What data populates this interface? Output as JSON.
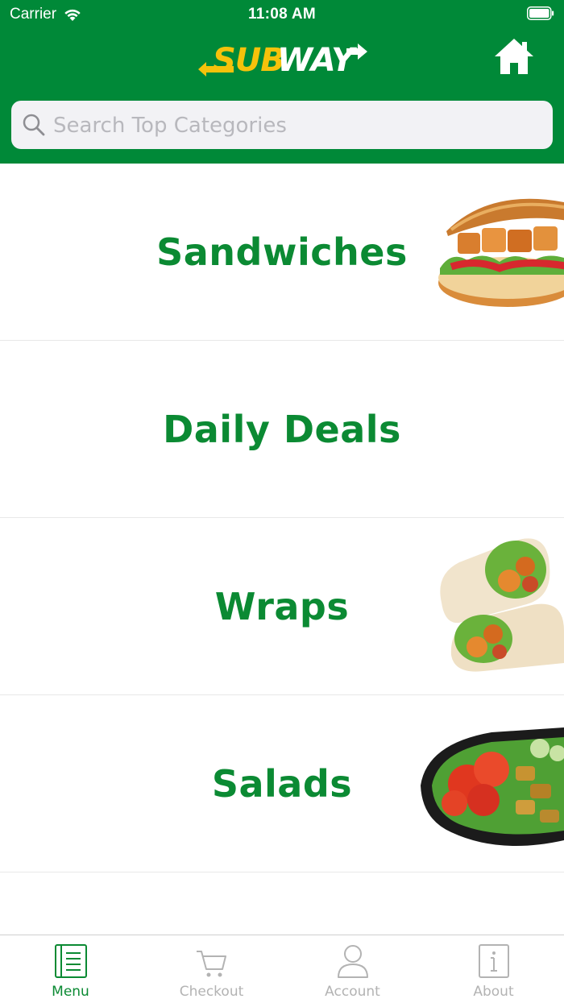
{
  "status_bar": {
    "carrier": "Carrier",
    "time": "11:08 AM"
  },
  "header": {
    "logo_text": "SUBWAY",
    "brand_green": "#008938",
    "brand_yellow": "#f5c20b"
  },
  "search": {
    "placeholder": "Search Top Categories",
    "value": ""
  },
  "categories": [
    {
      "label": "Sandwiches",
      "image": "sandwich-image"
    },
    {
      "label": "Daily Deals",
      "image": ""
    },
    {
      "label": "Wraps",
      "image": "wraps-image"
    },
    {
      "label": "Salads",
      "image": "salad-image"
    }
  ],
  "tabs": [
    {
      "label": "Menu",
      "icon": "menu-book-icon",
      "active": true
    },
    {
      "label": "Checkout",
      "icon": "cart-icon",
      "active": false
    },
    {
      "label": "Account",
      "icon": "person-icon",
      "active": false
    },
    {
      "label": "About",
      "icon": "info-icon",
      "active": false
    }
  ]
}
